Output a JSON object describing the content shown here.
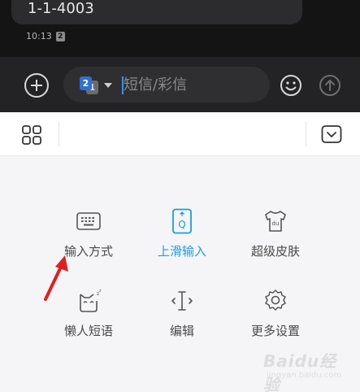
{
  "chat": {
    "last_message": "1-1-4003",
    "time": "10:13",
    "sim_badge": "2"
  },
  "compose": {
    "sim_primary": "2",
    "sim_secondary": "1",
    "placeholder": "短信/彩信",
    "accent_color": "#3c8fff"
  },
  "keyboard_menu": {
    "items": [
      {
        "label": "输入方式",
        "icon": "keyboard-icon",
        "active": false
      },
      {
        "label": "上滑输入",
        "icon": "swipe-input-icon",
        "active": true,
        "icon_letter": "Q"
      },
      {
        "label": "超级皮肤",
        "icon": "tshirt-skin-icon",
        "active": false,
        "icon_letter": "du"
      },
      {
        "label": "懒人短语",
        "icon": "cat-phrase-icon",
        "active": false
      },
      {
        "label": "编辑",
        "icon": "cursor-edit-icon",
        "active": false
      },
      {
        "label": "更多设置",
        "icon": "gear-icon",
        "active": false
      }
    ],
    "active_color": "#1a9de8"
  },
  "annotation": {
    "icon": "red-arrow-icon",
    "color": "#e02020"
  },
  "watermark": {
    "brand": "Baidu经验",
    "url": "jingyan.baidu.com"
  }
}
